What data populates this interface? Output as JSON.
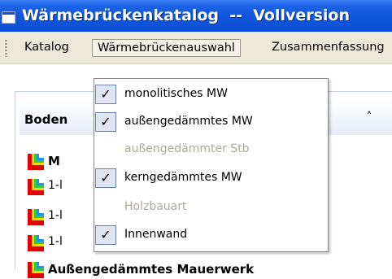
{
  "window": {
    "title": "Wärmebrückenkatalog  --  Vollversion"
  },
  "menubar": {
    "items": [
      {
        "label": "Katalog"
      },
      {
        "label": "Wärmebrückenauswahl"
      },
      {
        "label": "Zusammenfassung"
      }
    ]
  },
  "panel": {
    "group_title": "Boden",
    "rows": [
      {
        "label": "M"
      },
      {
        "label": "1-l"
      },
      {
        "label": "1-l"
      },
      {
        "label": "1-l"
      },
      {
        "label": "Außengedämmtes Mauerwerk"
      }
    ]
  },
  "dropdown": {
    "items": [
      {
        "label": "monolitisches MW",
        "checked": true,
        "enabled": true
      },
      {
        "label": "außengedämmtes MW",
        "checked": true,
        "enabled": true
      },
      {
        "label": "außengedämmter Stb",
        "checked": false,
        "enabled": false
      },
      {
        "label": "kerngedämmtes MW",
        "checked": true,
        "enabled": true
      },
      {
        "label": "Holzbauart",
        "checked": false,
        "enabled": false
      },
      {
        "label": "Innenwand",
        "checked": true,
        "enabled": true
      }
    ],
    "check_glyph": "✓"
  },
  "icons": {
    "collapse": "chevrons-up-icon",
    "row": "thermal-bridge-icon",
    "app": "app-window-icon"
  },
  "colors": {
    "titlebar": "#0f56de",
    "menubar": "#ece9d8",
    "disabled_text": "#aca899",
    "check_bg": "#dfe5f3"
  }
}
